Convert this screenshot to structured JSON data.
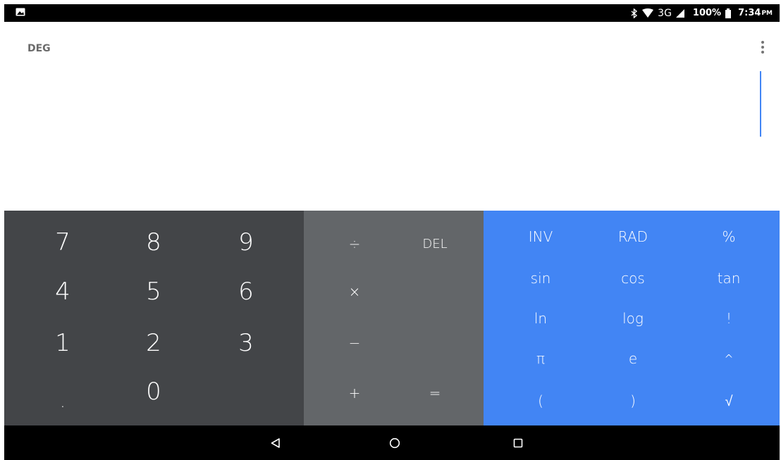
{
  "status_bar": {
    "left_icon": "image-icon",
    "icons": [
      "bluetooth-icon",
      "wifi-icon"
    ],
    "network": "3G",
    "battery": "100%",
    "time": "7:34",
    "ampm": "PM"
  },
  "display": {
    "mode": "DEG",
    "formula": ""
  },
  "numeric_pad": {
    "k7": "7",
    "k8": "8",
    "k9": "9",
    "k4": "4",
    "k5": "5",
    "k6": "6",
    "k1": "1",
    "k2": "2",
    "k3": "3",
    "dot": ".",
    "k0": "0"
  },
  "operator_pad": {
    "divide": "÷",
    "del": "DEL",
    "multiply": "×",
    "minus": "−",
    "plus": "+",
    "equals": "="
  },
  "advanced_pad": {
    "inv": "INV",
    "rad": "RAD",
    "percent": "%",
    "sin": "sin",
    "cos": "cos",
    "tan": "tan",
    "ln": "ln",
    "log": "log",
    "factorial": "!",
    "pi": "π",
    "e": "e",
    "power": "^",
    "lparen": "(",
    "rparen": ")",
    "sqrt": "√"
  },
  "colors": {
    "numeric_bg": "#434548",
    "operator_bg": "#636669",
    "advanced_bg": "#4285f4",
    "cursor": "#4285f4"
  },
  "nav_bar": {
    "icons": [
      "back-icon",
      "home-icon",
      "recents-icon"
    ]
  }
}
